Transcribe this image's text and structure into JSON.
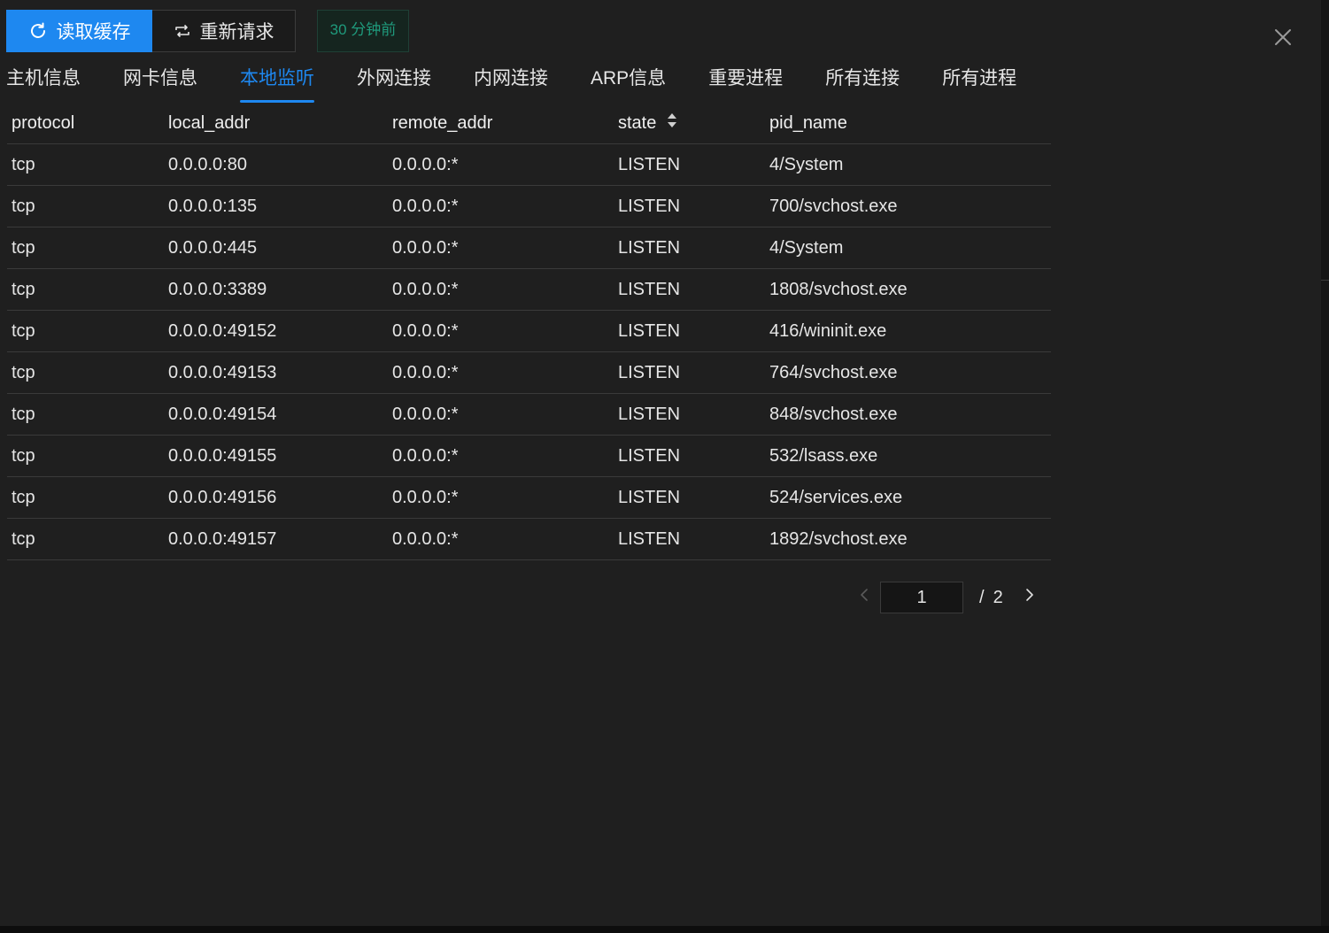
{
  "toolbar": {
    "read_cache_label": "读取缓存",
    "refresh_label": "重新请求",
    "cache_age": "30 分钟前"
  },
  "tabs": [
    {
      "label": "主机信息",
      "active": false
    },
    {
      "label": "网卡信息",
      "active": false
    },
    {
      "label": "本地监听",
      "active": true
    },
    {
      "label": "外网连接",
      "active": false
    },
    {
      "label": "内网连接",
      "active": false
    },
    {
      "label": "ARP信息",
      "active": false
    },
    {
      "label": "重要进程",
      "active": false
    },
    {
      "label": "所有连接",
      "active": false
    },
    {
      "label": "所有进程",
      "active": false
    }
  ],
  "table": {
    "columns": [
      "protocol",
      "local_addr",
      "remote_addr",
      "state",
      "pid_name"
    ],
    "rows": [
      [
        "tcp",
        "0.0.0.0:80",
        "0.0.0.0:*",
        "LISTEN",
        "4/System"
      ],
      [
        "tcp",
        "0.0.0.0:135",
        "0.0.0.0:*",
        "LISTEN",
        "700/svchost.exe"
      ],
      [
        "tcp",
        "0.0.0.0:445",
        "0.0.0.0:*",
        "LISTEN",
        "4/System"
      ],
      [
        "tcp",
        "0.0.0.0:3389",
        "0.0.0.0:*",
        "LISTEN",
        "1808/svchost.exe"
      ],
      [
        "tcp",
        "0.0.0.0:49152",
        "0.0.0.0:*",
        "LISTEN",
        "416/wininit.exe"
      ],
      [
        "tcp",
        "0.0.0.0:49153",
        "0.0.0.0:*",
        "LISTEN",
        "764/svchost.exe"
      ],
      [
        "tcp",
        "0.0.0.0:49154",
        "0.0.0.0:*",
        "LISTEN",
        "848/svchost.exe"
      ],
      [
        "tcp",
        "0.0.0.0:49155",
        "0.0.0.0:*",
        "LISTEN",
        "532/lsass.exe"
      ],
      [
        "tcp",
        "0.0.0.0:49156",
        "0.0.0.0:*",
        "LISTEN",
        "524/services.exe"
      ],
      [
        "tcp",
        "0.0.0.0:49157",
        "0.0.0.0:*",
        "LISTEN",
        "1892/svchost.exe"
      ]
    ]
  },
  "pagination": {
    "current_page": "1",
    "separator": "/",
    "total_pages": "2"
  },
  "icons": {
    "refresh": "refresh-icon",
    "repeat": "repeat-icon",
    "close": "close-icon",
    "sort": "sort-icon",
    "prev": "chevron-left-icon",
    "next": "chevron-right-icon"
  },
  "colors": {
    "accent": "#1e88f0",
    "background": "#1f1f1f",
    "tag_text": "#1f9a7c"
  }
}
